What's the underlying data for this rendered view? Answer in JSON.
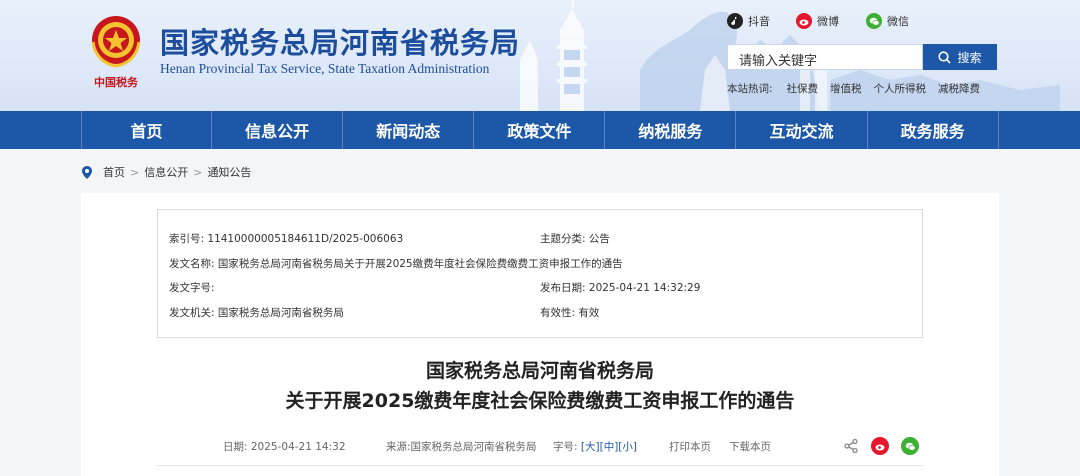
{
  "header": {
    "title": "国家税务总局河南省税务局",
    "subtitle": "Henan Provincial Tax Service, State Taxation Administration",
    "emblem_text": "中国税务",
    "social": [
      {
        "label": "抖音",
        "icon": "douyin-icon",
        "color": "#222222"
      },
      {
        "label": "微博",
        "icon": "weibo-icon",
        "color": "#e6162d"
      },
      {
        "label": "微信",
        "icon": "wechat-icon",
        "color": "#3cb034"
      }
    ],
    "search": {
      "placeholder": "请输入关键字",
      "button": "搜索"
    },
    "hot": {
      "label": "本站热词:",
      "words": [
        "社保费",
        "增值税",
        "个人所得税",
        "减税降费"
      ]
    }
  },
  "nav": {
    "items": [
      "首页",
      "信息公开",
      "新闻动态",
      "政策文件",
      "纳税服务",
      "互动交流",
      "政务服务"
    ],
    "color": "#1d57a7"
  },
  "breadcrumb": [
    "首页",
    "信息公开",
    "通知公告"
  ],
  "meta": {
    "index_label": "索引号:",
    "index_value": "11410000005184611D/2025-006063",
    "topic_label": "主题分类:",
    "topic_value": "公告",
    "doc_name_label": "发文名称:",
    "doc_name_value": "国家税务总局河南省税务局关于开展2025缴费年度社会保险费缴费工资申报工作的通告",
    "doc_no_label": "发文字号:",
    "doc_no_value": "",
    "pub_date_label": "发布日期:",
    "pub_date_value": "2025-04-21 14:32:29",
    "issuer_label": "发文机关:",
    "issuer_value": "国家税务总局河南省税务局",
    "validity_label": "有效性:",
    "validity_value": "有效"
  },
  "article": {
    "title_line1": "国家税务总局河南省税务局",
    "title_line2": "关于开展2025缴费年度社会保险费缴费工资申报工作的通告",
    "date": "日期: 2025-04-21 14:32",
    "source": "来源:国家税务总局河南省税务局",
    "font_label": "字号:",
    "font_sizes": [
      "[大]",
      "[中]",
      "[小]"
    ],
    "print": "打印本页",
    "download": "下载本页"
  }
}
